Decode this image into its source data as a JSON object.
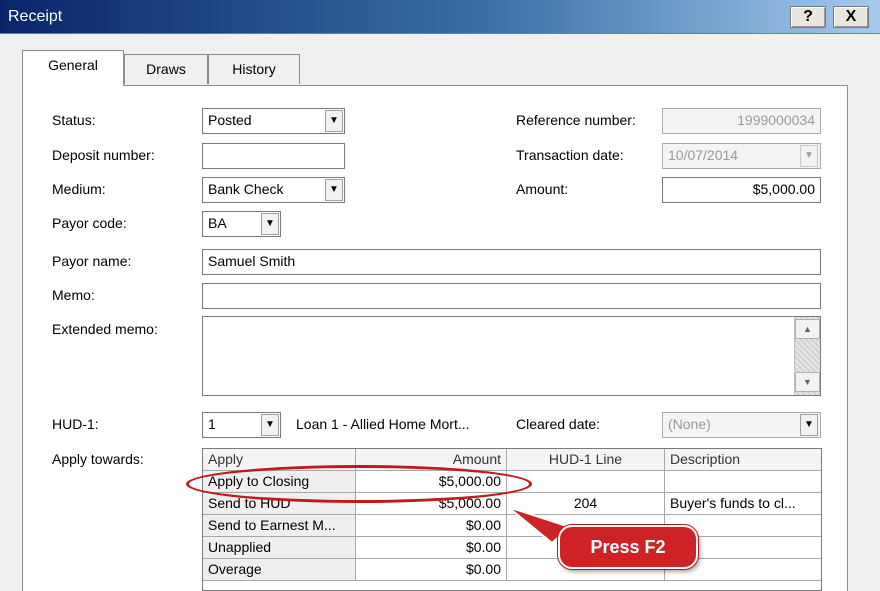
{
  "window": {
    "title": "Receipt",
    "help_label": "?",
    "close_label": "X"
  },
  "tabs": [
    {
      "label": "General",
      "active": true
    },
    {
      "label": "Draws",
      "active": false
    },
    {
      "label": "History",
      "active": false
    }
  ],
  "form": {
    "status": {
      "label": "Status:",
      "value": "Posted"
    },
    "deposit_number": {
      "label": "Deposit number:",
      "value": ""
    },
    "medium": {
      "label": "Medium:",
      "value": "Bank Check"
    },
    "payor_code": {
      "label": "Payor code:",
      "value": "BA"
    },
    "payor_name": {
      "label": "Payor name:",
      "value": "Samuel Smith"
    },
    "memo": {
      "label": "Memo:",
      "value": ""
    },
    "extended_memo": {
      "label": "Extended memo:",
      "value": ""
    },
    "hud1": {
      "label": "HUD-1:",
      "value": "1",
      "loan_text": "Loan 1 - Allied Home Mort..."
    },
    "apply_towards": {
      "label": "Apply towards:"
    },
    "reference_number": {
      "label": "Reference number:",
      "value": "1999000034"
    },
    "transaction_date": {
      "label": "Transaction date:",
      "value": "10/07/2014"
    },
    "amount": {
      "label": "Amount:",
      "value": "$5,000.00"
    },
    "cleared_date": {
      "label": "Cleared date:",
      "value": "(None)"
    }
  },
  "apply_grid": {
    "columns": [
      "Apply",
      "Amount",
      "HUD-1 Line",
      "Description"
    ],
    "rows": [
      {
        "apply": "Apply to Closing",
        "amount": "$5,000.00",
        "hud_line": "",
        "description": ""
      },
      {
        "apply": "Send to HUD",
        "amount": "$5,000.00",
        "hud_line": "204",
        "description": "Buyer's funds to cl..."
      },
      {
        "apply": "Send to Earnest M...",
        "amount": "$0.00",
        "hud_line": "",
        "description": ""
      },
      {
        "apply": "Unapplied",
        "amount": "$0.00",
        "hud_line": "",
        "description": ""
      },
      {
        "apply": "Overage",
        "amount": "$0.00",
        "hud_line": "",
        "description": ""
      }
    ]
  },
  "annotation": {
    "callout_text": "Press F2",
    "color": "#cf2227"
  },
  "icons": {
    "dropdown": "chevron-down-icon",
    "scroll_up": "arrow-up-icon",
    "scroll_down": "arrow-down-icon"
  }
}
